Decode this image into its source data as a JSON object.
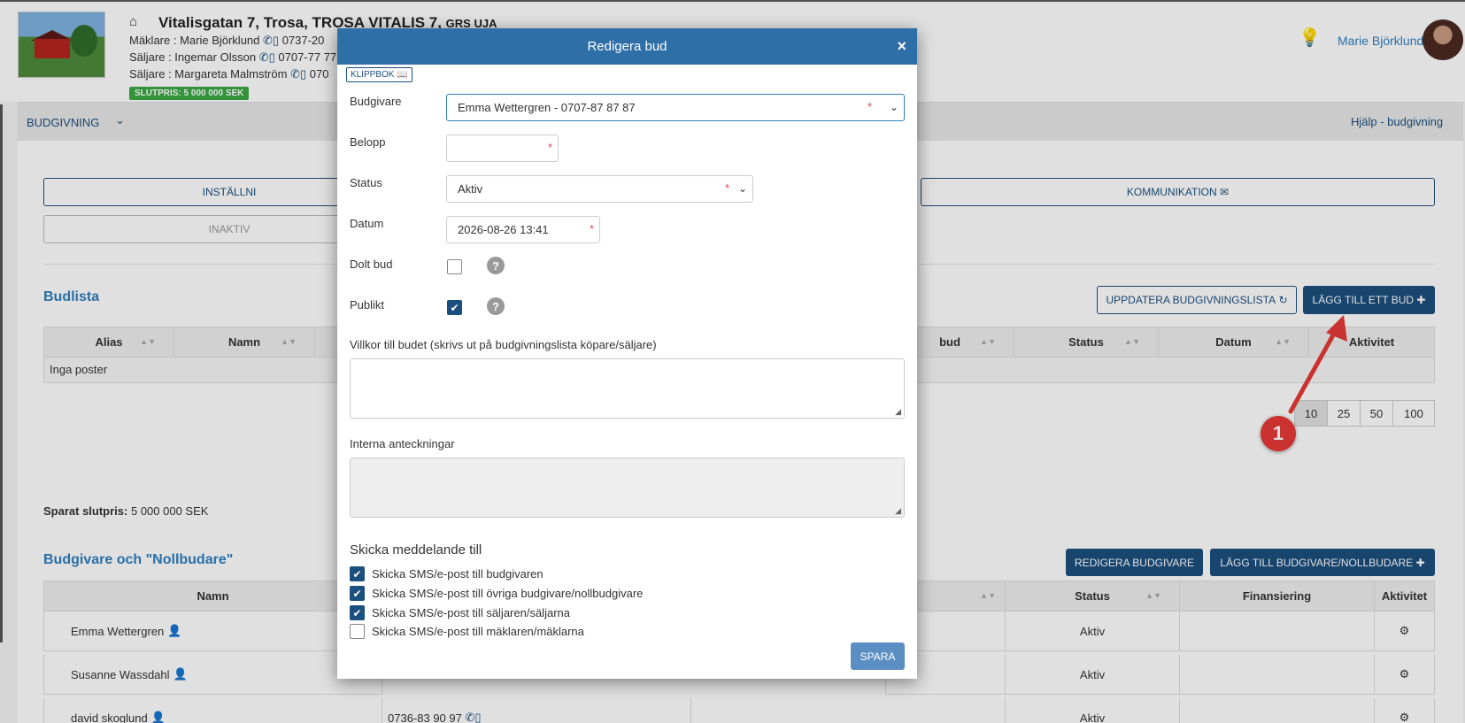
{
  "property": {
    "title": "Vitalisgatan 7, Trosa, TROSA VITALIS 7,",
    "title_suffix": "GRS UJA",
    "maklare": "Mäklare : Marie Björklund",
    "maklare_phone": "0737-20",
    "saljare1": "Säljare : Ingemar Olsson",
    "saljare1_phone": "0707-77 77",
    "saljare2": "Säljare : Margareta Malmström",
    "saljare2_phone": "070",
    "slutpris_badge": "SLUTPRIS: 5 000 000 SEK"
  },
  "user": {
    "name": "Marie Björklund"
  },
  "nav": {
    "section": "BUDGIVNING",
    "help": "Hjälp - budgivning"
  },
  "buttons": {
    "installningar": "INSTÄLLNI",
    "kommunikation": "KOMMUNIKATION",
    "inaktiv": "INAKTIV",
    "uppdatera": "UPPDATERA BUDGIVNINGSLISTA",
    "lagg_till_bud": "LÄGG TILL ETT BUD",
    "redigera_budgivare": "REDIGERA BUDGIVARE",
    "lagg_till_budgivare": "LÄGG TILL BUDGIVARE/NOLLBUDARE"
  },
  "budlista": {
    "title": "Budlista",
    "columns": [
      "Alias",
      "Namn",
      "bud",
      "Status",
      "Datum",
      "Aktivitet"
    ],
    "empty": "Inga poster",
    "page_sizes": [
      "10",
      "25",
      "50",
      "100"
    ]
  },
  "sparat": {
    "label": "Sparat slutpris:",
    "value": "5 000 000  SEK"
  },
  "budgivare": {
    "title": "Budgivare och \"Nollbudare\"",
    "columns": [
      "Namn",
      "Status",
      "Finansiering",
      "Aktivitet"
    ],
    "rows": [
      {
        "name": "Emma Wettergren",
        "phone": "",
        "status": "Aktiv"
      },
      {
        "name": "Susanne Wassdahl",
        "phone": "",
        "status": "Aktiv"
      },
      {
        "name": "david skoglund",
        "phone": "0736-83 90 97",
        "status": "Aktiv"
      }
    ]
  },
  "annotation": {
    "number": "1"
  },
  "modal": {
    "title": "Redigera bud",
    "close": "×",
    "klippbok": "KLIPPBOK",
    "budgivare_label": "Budgivare",
    "budgivare_value": "Emma Wettergren - 0707-87 87 87",
    "belopp_label": "Belopp",
    "belopp_value": "",
    "status_label": "Status",
    "status_value": "Aktiv",
    "datum_label": "Datum",
    "datum_value": "2026-08-26 13:41",
    "dolt_label": "Dolt bud",
    "dolt_checked": false,
    "publikt_label": "Publikt",
    "publikt_checked": true,
    "villkor_label": "Villkor till budet (skrivs ut på budgivningslista köpare/säljare)",
    "villkor_value": "",
    "interna_label": "Interna anteckningar",
    "interna_value": "",
    "send_title": "Skicka meddelande till",
    "send_options": [
      {
        "label": "Skicka SMS/e-post till budgivaren",
        "checked": true
      },
      {
        "label": "Skicka SMS/e-post till övriga budgivare/nollbudgivare",
        "checked": true
      },
      {
        "label": "Skicka SMS/e-post till säljaren/säljarna",
        "checked": true
      },
      {
        "label": "Skicka SMS/e-post till mäklaren/mäklarna",
        "checked": false
      }
    ],
    "save": "SPARA"
  },
  "colors": {
    "primary": "#1b4f7e",
    "header_blue": "#2f6fa8",
    "link_blue": "#2f7fbf",
    "badge_green": "#3aa843",
    "required": "#e04848",
    "annotation_red": "#e53935"
  }
}
